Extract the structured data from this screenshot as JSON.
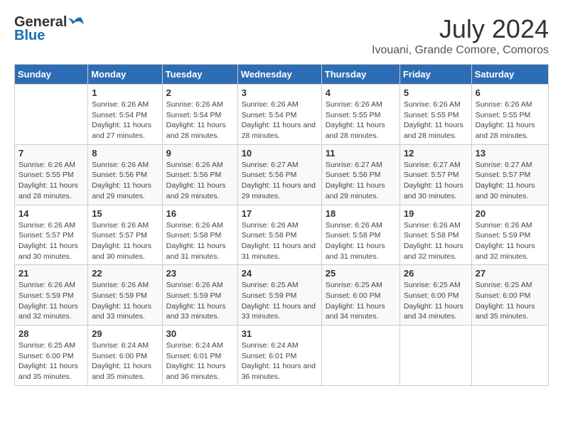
{
  "header": {
    "logo_general": "General",
    "logo_blue": "Blue",
    "month_year": "July 2024",
    "location": "Ivouani, Grande Comore, Comoros"
  },
  "calendar": {
    "days_of_week": [
      "Sunday",
      "Monday",
      "Tuesday",
      "Wednesday",
      "Thursday",
      "Friday",
      "Saturday"
    ],
    "weeks": [
      [
        {
          "day": "",
          "info": ""
        },
        {
          "day": "1",
          "info": "Sunrise: 6:26 AM\nSunset: 5:54 PM\nDaylight: 11 hours and 27 minutes."
        },
        {
          "day": "2",
          "info": "Sunrise: 6:26 AM\nSunset: 5:54 PM\nDaylight: 11 hours and 28 minutes."
        },
        {
          "day": "3",
          "info": "Sunrise: 6:26 AM\nSunset: 5:54 PM\nDaylight: 11 hours and 28 minutes."
        },
        {
          "day": "4",
          "info": "Sunrise: 6:26 AM\nSunset: 5:55 PM\nDaylight: 11 hours and 28 minutes."
        },
        {
          "day": "5",
          "info": "Sunrise: 6:26 AM\nSunset: 5:55 PM\nDaylight: 11 hours and 28 minutes."
        },
        {
          "day": "6",
          "info": "Sunrise: 6:26 AM\nSunset: 5:55 PM\nDaylight: 11 hours and 28 minutes."
        }
      ],
      [
        {
          "day": "7",
          "info": "Sunrise: 6:26 AM\nSunset: 5:55 PM\nDaylight: 11 hours and 28 minutes."
        },
        {
          "day": "8",
          "info": "Sunrise: 6:26 AM\nSunset: 5:56 PM\nDaylight: 11 hours and 29 minutes."
        },
        {
          "day": "9",
          "info": "Sunrise: 6:26 AM\nSunset: 5:56 PM\nDaylight: 11 hours and 29 minutes."
        },
        {
          "day": "10",
          "info": "Sunrise: 6:27 AM\nSunset: 5:56 PM\nDaylight: 11 hours and 29 minutes."
        },
        {
          "day": "11",
          "info": "Sunrise: 6:27 AM\nSunset: 5:56 PM\nDaylight: 11 hours and 29 minutes."
        },
        {
          "day": "12",
          "info": "Sunrise: 6:27 AM\nSunset: 5:57 PM\nDaylight: 11 hours and 30 minutes."
        },
        {
          "day": "13",
          "info": "Sunrise: 6:27 AM\nSunset: 5:57 PM\nDaylight: 11 hours and 30 minutes."
        }
      ],
      [
        {
          "day": "14",
          "info": "Sunrise: 6:26 AM\nSunset: 5:57 PM\nDaylight: 11 hours and 30 minutes."
        },
        {
          "day": "15",
          "info": "Sunrise: 6:26 AM\nSunset: 5:57 PM\nDaylight: 11 hours and 30 minutes."
        },
        {
          "day": "16",
          "info": "Sunrise: 6:26 AM\nSunset: 5:58 PM\nDaylight: 11 hours and 31 minutes."
        },
        {
          "day": "17",
          "info": "Sunrise: 6:26 AM\nSunset: 5:58 PM\nDaylight: 11 hours and 31 minutes."
        },
        {
          "day": "18",
          "info": "Sunrise: 6:26 AM\nSunset: 5:58 PM\nDaylight: 11 hours and 31 minutes."
        },
        {
          "day": "19",
          "info": "Sunrise: 6:26 AM\nSunset: 5:58 PM\nDaylight: 11 hours and 32 minutes."
        },
        {
          "day": "20",
          "info": "Sunrise: 6:26 AM\nSunset: 5:59 PM\nDaylight: 11 hours and 32 minutes."
        }
      ],
      [
        {
          "day": "21",
          "info": "Sunrise: 6:26 AM\nSunset: 5:59 PM\nDaylight: 11 hours and 32 minutes."
        },
        {
          "day": "22",
          "info": "Sunrise: 6:26 AM\nSunset: 5:59 PM\nDaylight: 11 hours and 33 minutes."
        },
        {
          "day": "23",
          "info": "Sunrise: 6:26 AM\nSunset: 5:59 PM\nDaylight: 11 hours and 33 minutes."
        },
        {
          "day": "24",
          "info": "Sunrise: 6:25 AM\nSunset: 5:59 PM\nDaylight: 11 hours and 33 minutes."
        },
        {
          "day": "25",
          "info": "Sunrise: 6:25 AM\nSunset: 6:00 PM\nDaylight: 11 hours and 34 minutes."
        },
        {
          "day": "26",
          "info": "Sunrise: 6:25 AM\nSunset: 6:00 PM\nDaylight: 11 hours and 34 minutes."
        },
        {
          "day": "27",
          "info": "Sunrise: 6:25 AM\nSunset: 6:00 PM\nDaylight: 11 hours and 35 minutes."
        }
      ],
      [
        {
          "day": "28",
          "info": "Sunrise: 6:25 AM\nSunset: 6:00 PM\nDaylight: 11 hours and 35 minutes."
        },
        {
          "day": "29",
          "info": "Sunrise: 6:24 AM\nSunset: 6:00 PM\nDaylight: 11 hours and 35 minutes."
        },
        {
          "day": "30",
          "info": "Sunrise: 6:24 AM\nSunset: 6:01 PM\nDaylight: 11 hours and 36 minutes."
        },
        {
          "day": "31",
          "info": "Sunrise: 6:24 AM\nSunset: 6:01 PM\nDaylight: 11 hours and 36 minutes."
        },
        {
          "day": "",
          "info": ""
        },
        {
          "day": "",
          "info": ""
        },
        {
          "day": "",
          "info": ""
        }
      ]
    ]
  }
}
